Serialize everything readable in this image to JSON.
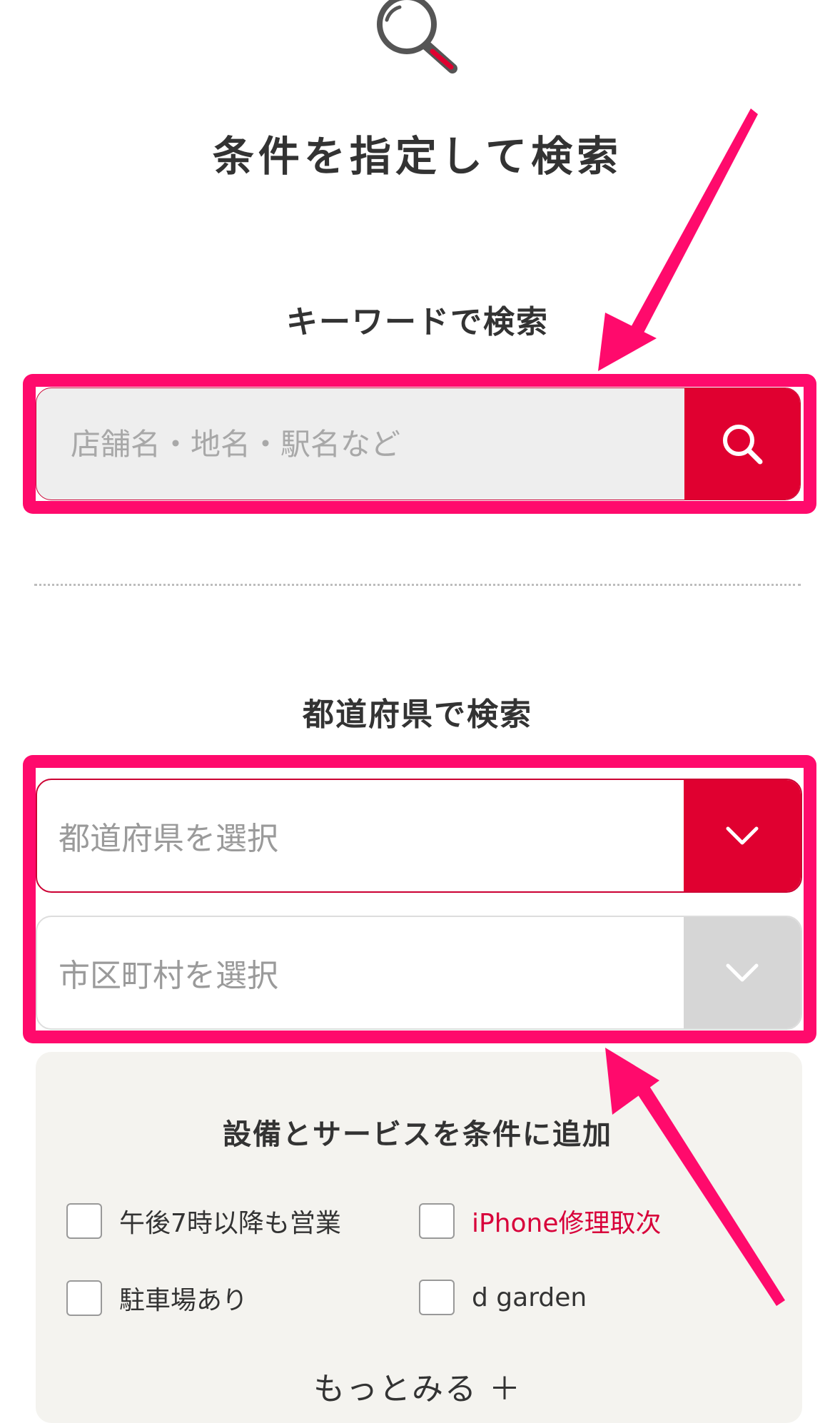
{
  "page_title": "条件を指定して検索",
  "keyword_search": {
    "title": "キーワードで検索",
    "placeholder": "店舗名・地名・駅名など"
  },
  "prefecture_search": {
    "title": "都道府県で検索",
    "prefecture_select_label": "都道府県を選択",
    "city_select_label": "市区町村を選択"
  },
  "facilities": {
    "title": "設備とサービスを条件に追加",
    "options": [
      {
        "label": "午後7時以降も営業"
      },
      {
        "label": "iPhone修理取次"
      },
      {
        "label": "駐車場あり"
      },
      {
        "label": "d garden"
      }
    ],
    "more_label": "もっとみる ＋"
  },
  "icons": {
    "top": "magnifier-icon",
    "search_button": "search-icon",
    "dropdown": "chevron-down-icon"
  },
  "colors": {
    "brand_red": "#e00030",
    "highlight_pink": "#ff0a6c",
    "panel_bg": "#f4f3ef"
  }
}
